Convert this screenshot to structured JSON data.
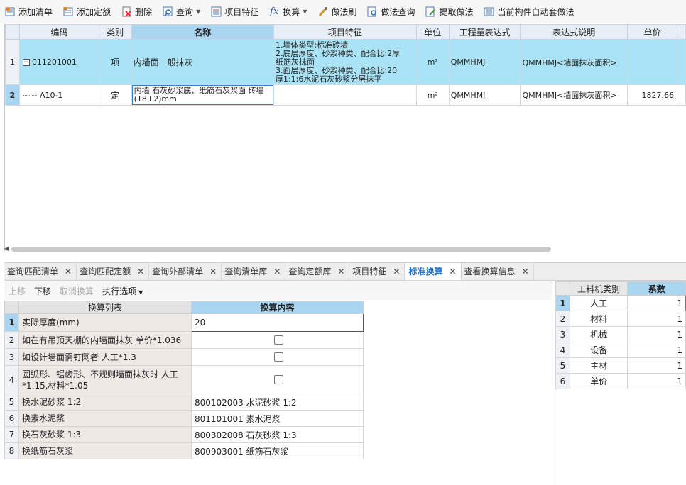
{
  "toolbar": {
    "add_list": "添加清单",
    "add_quota": "添加定额",
    "delete": "删除",
    "query": "查询",
    "item_feature": "项目特征",
    "convert": "换算",
    "method_brush": "做法刷",
    "method_query": "做法查询",
    "extract_method": "提取做法",
    "auto_apply": "当前构件自动套做法"
  },
  "top_grid": {
    "headers": [
      "编码",
      "类别",
      "名称",
      "项目特征",
      "单位",
      "工程量表达式",
      "表达式说明",
      "单价"
    ],
    "rows": [
      {
        "num": "1",
        "expand": "−",
        "code": "011201001",
        "type": "项",
        "name": "内墙面一般抹灰",
        "feature": "1.墙体类型:标准砖墙\n2.底层厚度、砂浆种类、配合比:2厚\n纸筋灰抹面\n3.面层厚度、砂浆种类、配合比:20\n厚1:1:6水泥石灰砂浆分层抹平",
        "unit": "m²",
        "expr": "QMMHMJ",
        "expr_desc": "QMMHMJ<墙面抹灰面积>",
        "price": ""
      },
      {
        "num": "2",
        "code": "A10-1",
        "type": "定",
        "name": "内墙 石灰砂浆底、纸筋石灰浆面 砖墙 (18+2)mm",
        "feature": "",
        "unit": "m²",
        "expr": "QMMHMJ",
        "expr_desc": "QMMHMJ<墙面抹灰面积>",
        "price": "1827.66"
      }
    ]
  },
  "tabs": [
    {
      "label": "查询匹配清单"
    },
    {
      "label": "查询匹配定额"
    },
    {
      "label": "查询外部清单"
    },
    {
      "label": "查询清单库"
    },
    {
      "label": "查询定额库"
    },
    {
      "label": "项目特征"
    },
    {
      "label": "标准换算"
    },
    {
      "label": "查看换算信息"
    }
  ],
  "sub_toolbar": {
    "up": "上移",
    "down": "下移",
    "cancel": "取消换算",
    "exec": "执行选项"
  },
  "conv_grid": {
    "headers": [
      "换算列表",
      "换算内容"
    ],
    "rows": [
      {
        "num": "1",
        "label": "实际厚度(mm)",
        "value": "20"
      },
      {
        "num": "2",
        "label": "如在有吊顶天棚的内墙面抹灰 单价*1.036",
        "value": ""
      },
      {
        "num": "3",
        "label": "如设计墙面需钉网者 人工*1.3",
        "value": ""
      },
      {
        "num": "4",
        "label": "圆弧形、锯齿形、不规则墙面抹灰时 人工*1.15,材料*1.05",
        "value": ""
      },
      {
        "num": "5",
        "label": "换水泥砂浆 1:2",
        "value": "800102003  水泥砂浆 1:2"
      },
      {
        "num": "6",
        "label": "换素水泥浆",
        "value": "801101001  素水泥浆"
      },
      {
        "num": "7",
        "label": "换石灰砂浆 1:3",
        "value": "800302008  石灰砂浆 1:3"
      },
      {
        "num": "8",
        "label": "换纸筋石灰浆",
        "value": "800903001  纸筋石灰浆"
      }
    ]
  },
  "coef_grid": {
    "headers": [
      "工料机类别",
      "系数"
    ],
    "rows": [
      {
        "num": "1",
        "cat": "人工",
        "coef": "1"
      },
      {
        "num": "2",
        "cat": "材料",
        "coef": "1"
      },
      {
        "num": "3",
        "cat": "机械",
        "coef": "1"
      },
      {
        "num": "4",
        "cat": "设备",
        "coef": "1"
      },
      {
        "num": "5",
        "cat": "主材",
        "coef": "1"
      },
      {
        "num": "6",
        "cat": "单价",
        "coef": "1"
      }
    ]
  }
}
